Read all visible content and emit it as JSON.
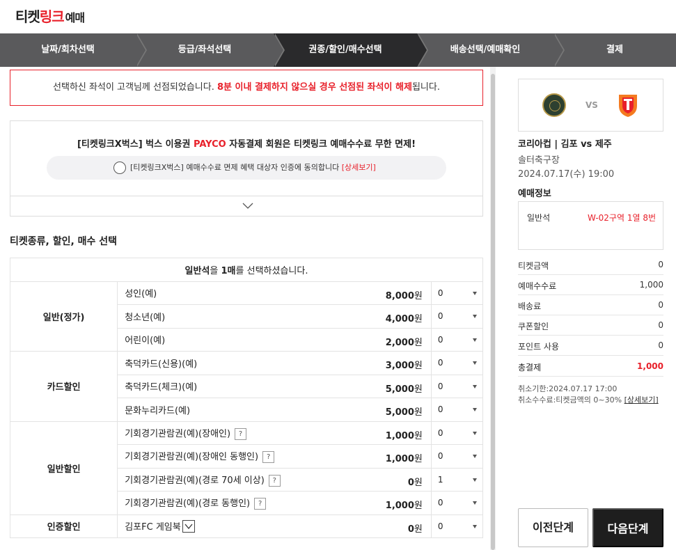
{
  "header": {
    "logo_part1": "티켓",
    "logo_part2": "링크",
    "logo_part3": "예매"
  },
  "steps": [
    {
      "label": "날짜/회차선택",
      "active": false
    },
    {
      "label": "등급/좌석선택",
      "active": false
    },
    {
      "label": "권종/할인/매수선택",
      "active": true
    },
    {
      "label": "배송선택/예매확인",
      "active": false
    },
    {
      "label": "결제",
      "active": false
    }
  ],
  "notice": {
    "text_before": "선택하신 좌석이 고객님께 선점되었습니다. ",
    "text_red": "8분 이내 결제하지 않으실 경우 선점된 좌석이 해제",
    "text_after": "됩니다."
  },
  "promo": {
    "title_before": "[티켓링크X벅스] 벅스 이용권 ",
    "title_payco": "PAYCO",
    "title_after": " 자동결제 회원은 티켓링크 예매수수료 무한 면제!",
    "agree_text": "[티켓링크X벅스] 예매수수료 면제 혜택 대상자 인증에 동의합니다 ",
    "agree_detail": "[상세보기]"
  },
  "section_title": "티켓종류, 할인, 매수 선택",
  "ticket_header": {
    "grade": "일반석",
    "mid": "을 ",
    "count": "1매",
    "end": "를 선택하셨습니다."
  },
  "categories": [
    {
      "name": "일반(정가)",
      "items": [
        {
          "label": "성인(예)",
          "price": "8,000",
          "unit": "원",
          "qty": "0",
          "help": false
        },
        {
          "label": "청소년(예)",
          "price": "4,000",
          "unit": "원",
          "qty": "0",
          "help": false
        },
        {
          "label": "어린이(예)",
          "price": "2,000",
          "unit": "원",
          "qty": "0",
          "help": false
        }
      ]
    },
    {
      "name": "카드할인",
      "items": [
        {
          "label": "축덕카드(신용)(예)",
          "price": "3,000",
          "unit": "원",
          "qty": "0",
          "help": false
        },
        {
          "label": "축덕카드(체크)(예)",
          "price": "5,000",
          "unit": "원",
          "qty": "0",
          "help": false
        },
        {
          "label": "문화누리카드(예)",
          "price": "5,000",
          "unit": "원",
          "qty": "0",
          "help": false
        }
      ]
    },
    {
      "name": "일반할인",
      "items": [
        {
          "label": "기회경기관람권(예)(장애인)",
          "price": "1,000",
          "unit": "원",
          "qty": "0",
          "help": true
        },
        {
          "label": "기회경기관람권(예)(장애인 동행인)",
          "price": "1,000",
          "unit": "원",
          "qty": "0",
          "help": true
        },
        {
          "label": "기회경기관람권(예)(경로 70세 이상)",
          "price": "0",
          "unit": "원",
          "qty": "1",
          "help": true
        },
        {
          "label": "기회경기관람권(예)(경로 동행인)",
          "price": "1,000",
          "unit": "원",
          "qty": "0",
          "help": true
        }
      ]
    },
    {
      "name": "인증할인",
      "items": [
        {
          "label": "김포FC 게임북",
          "price": "0",
          "unit": "원",
          "qty": "0",
          "help": false,
          "check": true
        }
      ]
    }
  ],
  "help_mark": "?",
  "side": {
    "vs": "VS",
    "match_title": "코리아컵 | 김포 vs 제주",
    "venue": "솔터축구장",
    "datetime": "2024.07.17(수) 19:00",
    "info_title": "예매정보",
    "seat_grade": "일반석",
    "seat_no": "W-02구역 1열 8번",
    "fees": [
      {
        "label": "티켓금액",
        "value": "0"
      },
      {
        "label": "예매수수료",
        "value": "1,000"
      },
      {
        "label": "배송료",
        "value": "0"
      },
      {
        "label": "쿠폰할인",
        "value": "0"
      },
      {
        "label": "포인트 사용",
        "value": "0"
      }
    ],
    "total_label": "총결제",
    "total_value": "1,000",
    "cancel_deadline": "취소기한:2024.07.17 17:00",
    "cancel_fee": "취소수수료:티켓금액의 0~30% ",
    "cancel_link": "[상세보기]",
    "prev_button": "이전단계",
    "next_button": "다음단계"
  },
  "colors": {
    "accent_red": "#e8202a",
    "step_bg": "#5a5a5c",
    "step_active": "#2a2a2c"
  }
}
